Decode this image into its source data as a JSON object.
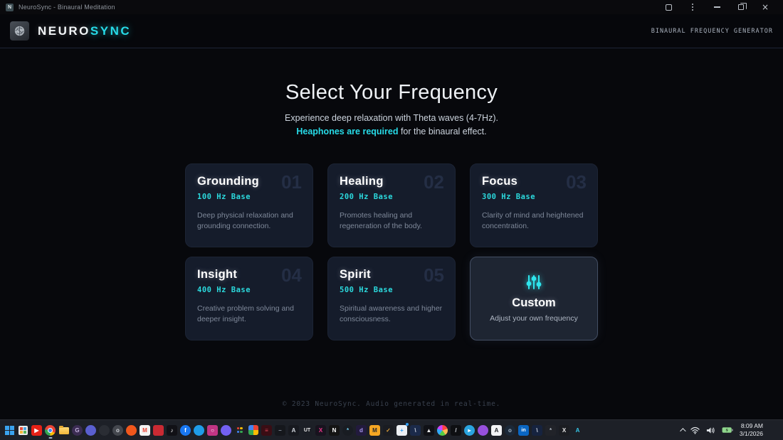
{
  "titlebar": {
    "app_icon_letter": "N",
    "app_title": "NeuroSync - Binaural Meditation"
  },
  "header": {
    "brand_primary": "NEURO",
    "brand_accent": "SYNC",
    "tagline": "BINAURAL FREQUENCY GENERATOR"
  },
  "hero": {
    "title": "Select Your Frequency",
    "subtitle_line1": "Experience deep relaxation with Theta waves (4-7Hz).",
    "subtitle_highlight": "Heaphones are required",
    "subtitle_rest": " for the binaural effect."
  },
  "cards": [
    {
      "title": "Grounding",
      "number": "01",
      "frequency": "100 Hz Base",
      "description": "Deep physical relaxation and grounding connection."
    },
    {
      "title": "Healing",
      "number": "02",
      "frequency": "200 Hz Base",
      "description": "Promotes healing and regeneration of the body."
    },
    {
      "title": "Focus",
      "number": "03",
      "frequency": "300 Hz Base",
      "description": "Clarity of mind and heightened concentration."
    },
    {
      "title": "Insight",
      "number": "04",
      "frequency": "400 Hz Base",
      "description": "Creative problem solving and deeper insight."
    },
    {
      "title": "Spirit",
      "number": "05",
      "frequency": "500 Hz Base",
      "description": "Spiritual awareness and higher consciousness."
    }
  ],
  "custom_card": {
    "icon": "sliders-icon",
    "title": "Custom",
    "description": "Adjust your own frequency"
  },
  "footer": {
    "copyright": "© 2023 NeuroSync. Audio generated in real-time."
  },
  "colors": {
    "accent_cyan": "#27dbe8",
    "card_background": "#151c2b",
    "custom_card_background": "#1e2532",
    "page_background": "#07080c",
    "taskbar_background": "#1d2027"
  },
  "taskbar": {
    "icons": [
      {
        "name": "start-button",
        "shape": "windows"
      },
      {
        "name": "microsoft-store",
        "shape": "tiles"
      },
      {
        "name": "youtube",
        "shape": "letter",
        "form": "rsquare",
        "bg": "#e62117",
        "glyph": "▶",
        "fg": "#ffffff"
      },
      {
        "name": "chrome",
        "shape": "chrome",
        "active": true
      },
      {
        "name": "file-explorer",
        "shape": "folder"
      },
      {
        "name": "gog-galaxy",
        "shape": "letter",
        "form": "circle",
        "bg": "#3b2c52",
        "glyph": "G",
        "fg": "#c3b1dd"
      },
      {
        "name": "discord",
        "shape": "letter",
        "form": "circle",
        "bg": "#5a5fd0",
        "glyph": "",
        "fg": "#ffffff"
      },
      {
        "name": "dark-circle-app",
        "shape": "letter",
        "form": "circle",
        "bg": "#2a2d34",
        "glyph": "",
        "fg": "#9aa"
      },
      {
        "name": "camera-app",
        "shape": "letter",
        "form": "circle",
        "bg": "#44474e",
        "glyph": "o",
        "fg": "#cfd3d8"
      },
      {
        "name": "soundcloud",
        "shape": "letter",
        "form": "circle",
        "bg": "#f1571c",
        "glyph": "",
        "fg": "#ffffff"
      },
      {
        "name": "gmail",
        "shape": "letter",
        "form": "rsquare",
        "bg": "#f3f3f3",
        "glyph": "M",
        "fg": "#ea4335"
      },
      {
        "name": "adobe-app",
        "shape": "letter",
        "form": "rsquare",
        "bg": "#ca2a33",
        "glyph": "",
        "fg": "#ffffff"
      },
      {
        "name": "tiktok",
        "shape": "letter",
        "form": "rsquare",
        "bg": "#111116",
        "glyph": "♪",
        "fg": "#ffffff"
      },
      {
        "name": "facebook",
        "shape": "letter",
        "form": "circle",
        "bg": "#1877f2",
        "glyph": "f",
        "fg": "#ffffff"
      },
      {
        "name": "messenger-app",
        "shape": "letter",
        "form": "circle",
        "bg": "#1f9ce8",
        "glyph": "",
        "fg": "#ffffff"
      },
      {
        "name": "instagram",
        "shape": "letter",
        "form": "rsquare",
        "bg": "#c13584",
        "glyph": "○",
        "fg": "#ffffff"
      },
      {
        "name": "viber",
        "shape": "letter",
        "form": "circle",
        "bg": "#7360f2",
        "glyph": "",
        "fg": "#ffffff"
      },
      {
        "name": "google-app-grid",
        "shape": "dots"
      },
      {
        "name": "google-photos",
        "shape": "pinwheel"
      },
      {
        "name": "striped-red-app",
        "shape": "letter",
        "form": "rsquare",
        "bg": "#3a0d14",
        "glyph": "≡",
        "fg": "#d84455"
      },
      {
        "name": "dash-dark-app",
        "shape": "letter",
        "form": "rsquare",
        "bg": "#15171c",
        "glyph": "–",
        "fg": "#8b94a1"
      },
      {
        "name": "a-dark-app",
        "shape": "letter",
        "form": "rsquare",
        "bg": "#17191f",
        "glyph": "A",
        "fg": "#d2d6dc"
      },
      {
        "name": "ut-app",
        "shape": "letter",
        "form": "rsquare",
        "bg": "#1c1f26",
        "glyph": "UT",
        "fg": "#eaeaea"
      },
      {
        "name": "pink-x-app",
        "shape": "letter",
        "form": "rsquare",
        "bg": "#18131e",
        "glyph": "X",
        "fg": "#f0368c"
      },
      {
        "name": "notion",
        "shape": "letter",
        "form": "rsquare",
        "bg": "#141414",
        "glyph": "N",
        "fg": "#ffffff"
      },
      {
        "name": "swirl-app",
        "shape": "letter",
        "form": "circle",
        "bg": "#191c22",
        "glyph": "*",
        "fg": "#6fc8e8"
      },
      {
        "name": "d-purple-app",
        "shape": "letter",
        "form": "rsquare",
        "bg": "#221a3d",
        "glyph": "d",
        "fg": "#a695ef"
      },
      {
        "name": "m-orange-app",
        "shape": "letter",
        "form": "rsquare",
        "bg": "#f5a623",
        "glyph": "M",
        "fg": "#2a2a2a"
      },
      {
        "name": "check-app",
        "shape": "letter",
        "form": "rsquare",
        "bg": "#1a1c22",
        "glyph": "✓",
        "fg": "#e0a23a"
      },
      {
        "name": "paint-app",
        "shape": "letter",
        "form": "rsquare",
        "bg": "#eef0f4",
        "glyph": "+",
        "fg": "#2a9df4",
        "notif": true
      },
      {
        "name": "notepad-plus-app",
        "shape": "letter",
        "form": "rsquare",
        "bg": "#1b2a4a",
        "glyph": "\\",
        "fg": "#d2d9e6"
      },
      {
        "name": "play-dark-app",
        "shape": "letter",
        "form": "rsquare",
        "bg": "#101116",
        "glyph": "▲",
        "fg": "#eaeaea"
      },
      {
        "name": "palette-app",
        "shape": "palette"
      },
      {
        "name": "pen-app",
        "shape": "letter",
        "form": "rsquare",
        "bg": "#0e0f12",
        "glyph": "/",
        "fg": "#ced3da"
      },
      {
        "name": "telegram",
        "shape": "letter",
        "form": "circle",
        "bg": "#2aa4e0",
        "glyph": "▸",
        "fg": "#ffffff"
      },
      {
        "name": "github-app",
        "shape": "letter",
        "form": "circle",
        "bg": "#9750dd",
        "glyph": "",
        "fg": "#ffffff"
      },
      {
        "name": "a-white-app",
        "shape": "letter",
        "form": "rsquare",
        "bg": "#f2f3f5",
        "glyph": "A",
        "fg": "#24262b"
      },
      {
        "name": "steam",
        "shape": "letter",
        "form": "circle",
        "bg": "#1b2838",
        "glyph": "o",
        "fg": "#a4b8cc"
      },
      {
        "name": "linkedin",
        "shape": "letter",
        "form": "rsquare",
        "bg": "#0a66c2",
        "glyph": "in",
        "fg": "#ffffff"
      },
      {
        "name": "notepad-blue-app",
        "shape": "letter",
        "form": "rsquare",
        "bg": "#16233f",
        "glyph": "\\",
        "fg": "#d2d9e6"
      },
      {
        "name": "gear-app",
        "shape": "letter",
        "form": "rsquare",
        "bg": "#212329",
        "glyph": "*",
        "fg": "#aab2bc"
      },
      {
        "name": "x-dark-app",
        "shape": "letter",
        "form": "rsquare",
        "bg": "#1b1d22",
        "glyph": "X",
        "fg": "#e8e8e8"
      },
      {
        "name": "caret-cyan-app",
        "shape": "letter",
        "form": "rsquare",
        "bg": "transparent",
        "glyph": "A",
        "fg": "#35c7e8"
      }
    ],
    "tray": {
      "icons": [
        "chevron-up-icon",
        "wifi-icon",
        "volume-icon",
        "battery-icon"
      ],
      "time": "8:09 AM",
      "date": "3/1/2026"
    }
  }
}
